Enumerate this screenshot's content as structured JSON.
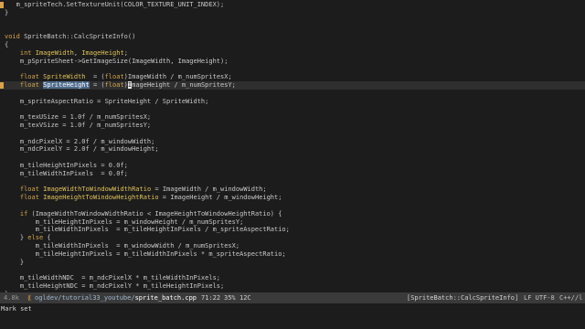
{
  "editor": {
    "lines": [
      {
        "text": "   m_spriteTech.SetTextureUnit(COLOR_TEXTURE_UNIT_INDEX);",
        "indicator": true
      },
      {
        "text": "}"
      },
      {
        "text": ""
      },
      {
        "text": ""
      },
      {
        "text": "void SpriteBatch::CalcSpriteInfo()",
        "kind": "decl"
      },
      {
        "text": "{"
      },
      {
        "text": "    int ImageWidth, ImageHeight;",
        "kind": "intdecl"
      },
      {
        "text": "    m_pSpriteSheet->GetImageSize(ImageWidth, ImageHeight);"
      },
      {
        "text": ""
      },
      {
        "text": "    float SpriteWidth  = (float)ImageWidth / m_numSpritesX;",
        "kind": "floatdecl"
      },
      {
        "text": "    float SpriteHeight = (float)ImageHeight / m_numSpritesY;",
        "kind": "current",
        "indicator": true
      },
      {
        "text": ""
      },
      {
        "text": "    m_spriteAspectRatio = SpriteHeight / SpriteWidth;"
      },
      {
        "text": ""
      },
      {
        "text": "    m_texUSize = 1.0f / m_numSpritesX;"
      },
      {
        "text": "    m_texVSize = 1.0f / m_numSpritesY;"
      },
      {
        "text": ""
      },
      {
        "text": "    m_ndcPixelX = 2.0f / m_windowWidth;"
      },
      {
        "text": "    m_ndcPixelY = 2.0f / m_windowHeight;"
      },
      {
        "text": ""
      },
      {
        "text": "    m_tileHeightInPixels = 0.0f;"
      },
      {
        "text": "    m_tileWidthInPixels  = 0.0f;"
      },
      {
        "text": ""
      },
      {
        "text": "    float ImageWidthToWindowWidthRatio = ImageWidth / m_windowWidth;",
        "kind": "floatdecl"
      },
      {
        "text": "    float ImageHeightToWindowHeightRatio = ImageHeight / m_windowHeight;",
        "kind": "floatdecl"
      },
      {
        "text": ""
      },
      {
        "text": "    if (ImageWidthToWindowWidthRatio < ImageHeightToWindowHeightRatio) {",
        "kind": "if"
      },
      {
        "text": "        m_tileHeightInPixels = m_windowHeight / m_numSpritesY;"
      },
      {
        "text": "        m_tileWidthInPixels  = m_tileHeightInPixels / m_spriteAspectRatio;"
      },
      {
        "text": "    } else {",
        "kind": "else"
      },
      {
        "text": "        m_tileWidthInPixels  = m_windowWidth / m_numSpritesX;"
      },
      {
        "text": "        m_tileHeightInPixels = m_tileWidthInPixels * m_spriteAspectRatio;"
      },
      {
        "text": "    }"
      },
      {
        "text": ""
      },
      {
        "text": "    m_tileWidthNDC  = m_ndcPixelX * m_tileWidthInPixels;"
      },
      {
        "text": "    m_tileHeightNDC = m_ndcPixelY * m_tileHeightInPixels;"
      },
      {
        "text": "}"
      }
    ]
  },
  "modeline": {
    "size": "4.8k",
    "path_dir": "ogldev/tutorial33_youtube/",
    "path_file": "sprite_batch.cpp",
    "position": "71:22",
    "percent": "35%",
    "column": "12C",
    "function": "[SpriteBatch::CalcSpriteInfo]",
    "encoding": "LF UTF-8",
    "mode": "C++//l"
  },
  "echo": {
    "message": "Mark set"
  },
  "colors": {
    "background": "#1c1c1c",
    "keyword": "#d4a34a",
    "variable": "#e0c25a",
    "selection": "#4d6a8c",
    "modeline_bg": "#3a3a3a"
  }
}
